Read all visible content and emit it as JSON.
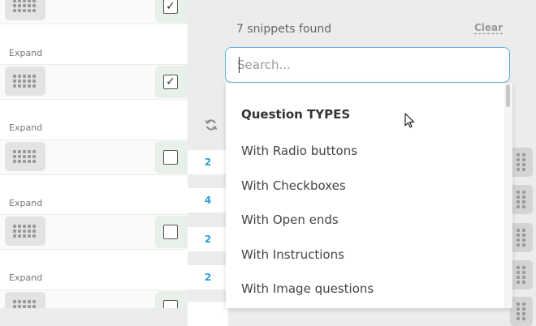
{
  "left_panel": {
    "rows": [
      {
        "checked": true
      },
      {
        "checked": true
      },
      {
        "checked": false
      },
      {
        "checked": false
      },
      {
        "checked": false
      }
    ],
    "expand_label": "Expand"
  },
  "dropdown": {
    "count_text": "7 snippets found",
    "clear_label": "Clear",
    "search_placeholder": "Search...",
    "heading": "Question TYPES",
    "items": [
      "With Radio buttons",
      "With Checkboxes",
      "With Open ends",
      "With Instructions",
      "With Image questions"
    ]
  },
  "badges": [
    "2",
    "4",
    "2",
    "2"
  ],
  "check_mark": "✓",
  "colors": {
    "accent": "#2a9fd6",
    "search_border": "#5aaed6",
    "check_zone": "#e8f0ea"
  }
}
